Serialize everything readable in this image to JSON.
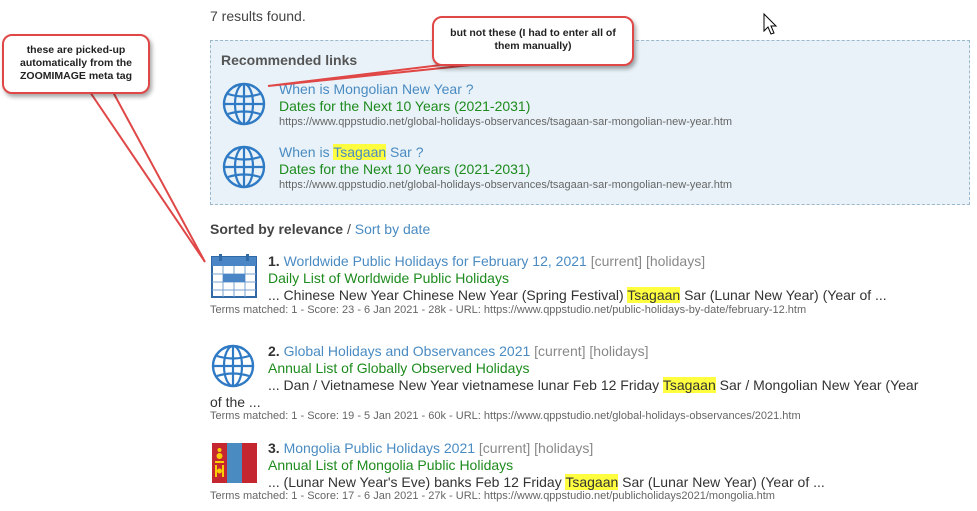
{
  "results_count": "7 results found.",
  "recommended": {
    "title": "Recommended links",
    "items": [
      {
        "title_pre": "When is Mongolian New Year ?",
        "title_hl": "",
        "title_post": "",
        "subtitle": "Dates for the Next 10 Years (2021-2031)",
        "url": "https://www.qppstudio.net/global-holidays-observances/tsagaan-sar-mongolian-new-year.htm",
        "icon": "globe-icon"
      },
      {
        "title_pre": "When is ",
        "title_hl": "Tsagaan",
        "title_post": " Sar ?",
        "subtitle": "Dates for the Next 10 Years (2021-2031)",
        "url": "https://www.qppstudio.net/global-holidays-observances/tsagaan-sar-mongolian-new-year.htm",
        "icon": "globe-icon"
      }
    ]
  },
  "sort": {
    "label": "Sorted by relevance",
    "separator": " / ",
    "alt_link": "Sort by date"
  },
  "results": [
    {
      "num": "1.",
      "title": "Worldwide Public Holidays for February 12, 2021",
      "tags": "[current] [holidays]",
      "subtitle": "Daily List of Worldwide Public Holidays",
      "desc_pre": "... Chinese New Year Chinese New Year (Spring Festival) ",
      "desc_hl": "Tsagaan",
      "desc_post": " Sar (Lunar New Year) (Year of ...",
      "meta": "Terms matched: 1  -  Score: 23  -  6 Jan 2021  -  28k  -  URL: https://www.qppstudio.net/public-holidays-by-date/february-12.htm",
      "icon": "calendar-icon"
    },
    {
      "num": "2.",
      "title": "Global Holidays and Observances 2021",
      "tags": "[current] [holidays]",
      "subtitle": "Annual List of Globally Observed Holidays",
      "desc_pre": "... Dan / Vietnamese New Year vietnamese lunar Feb 12 Friday ",
      "desc_hl": "Tsagaan",
      "desc_post": " Sar / Mongolian New Year (Year",
      "desc_wrap": "of the ...",
      "meta": "Terms matched: 1  -  Score: 19  -  5 Jan 2021  -  60k  -  URL: https://www.qppstudio.net/global-holidays-observances/2021.htm",
      "icon": "globe-icon"
    },
    {
      "num": "3.",
      "title": "Mongolia Public Holidays 2021",
      "tags": "[current] [holidays]",
      "subtitle": "Annual List of Mongolia Public Holidays",
      "desc_pre": "... (Lunar New Year's Eve) banks Feb 12 Friday ",
      "desc_hl": "Tsagaan",
      "desc_post": " Sar (Lunar New Year) (Year of ...",
      "meta": "Terms matched: 1  -  Score: 17  -  6 Jan 2021  -  27k  -  URL: https://www.qppstudio.net/publicholidays2021/mongolia.htm",
      "icon": "mongolia-flag-icon"
    }
  ],
  "callouts": {
    "left": "these are picked-up automatically from the ZOOMIMAGE meta tag",
    "right": "but not these (I had to enter all of them manually)"
  },
  "colors": {
    "link": "#4a8bc2",
    "green": "#1e8b1e",
    "highlight": "#ffff40",
    "callout_border": "#e04848",
    "rec_bg": "#e8f2f8"
  }
}
